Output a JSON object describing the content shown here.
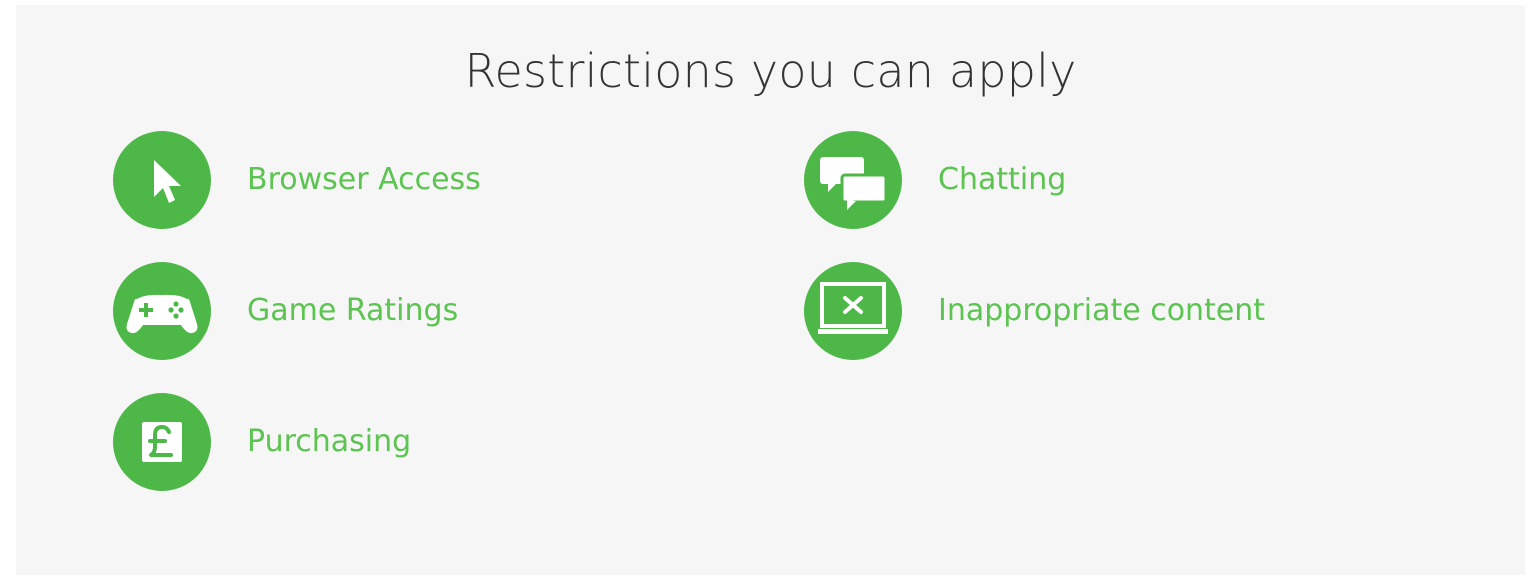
{
  "section": {
    "title": "Restrictions you can apply"
  },
  "colors": {
    "accent": "#4db848",
    "label": "#5cc450",
    "title": "#333333",
    "panel_background": "#f6f6f6"
  },
  "restrictions": [
    {
      "label": "Browser Access",
      "icon": "cursor-icon"
    },
    {
      "label": "Chatting",
      "icon": "chat-bubbles-icon"
    },
    {
      "label": "Game Ratings",
      "icon": "gamepad-icon"
    },
    {
      "label": "Inappropriate content",
      "icon": "blocked-screen-icon"
    },
    {
      "label": "Purchasing",
      "icon": "pound-sign-icon"
    }
  ]
}
